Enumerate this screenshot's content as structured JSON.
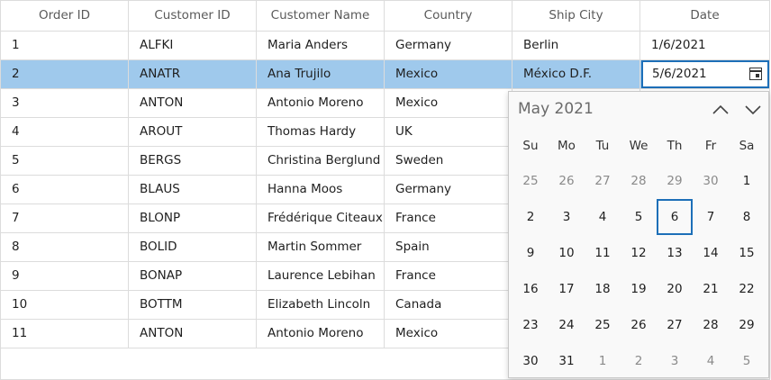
{
  "grid": {
    "columns": [
      "Order ID",
      "Customer ID",
      "Customer Name",
      "Country",
      "Ship City",
      "Date"
    ],
    "rows": [
      [
        "1",
        "ALFKI",
        "Maria Anders",
        "Germany",
        "Berlin",
        "1/6/2021"
      ],
      [
        "2",
        "ANATR",
        "Ana Trujilo",
        "Mexico",
        "México D.F.",
        ""
      ],
      [
        "3",
        "ANTON",
        "Antonio Moreno",
        "Mexico",
        "",
        ""
      ],
      [
        "4",
        "AROUT",
        "Thomas Hardy",
        "UK",
        "",
        ""
      ],
      [
        "5",
        "BERGS",
        "Christina Berglund",
        "Sweden",
        "",
        ""
      ],
      [
        "6",
        "BLAUS",
        "Hanna Moos",
        "Germany",
        "",
        ""
      ],
      [
        "7",
        "BLONP",
        "Frédérique Citeaux",
        "France",
        "",
        ""
      ],
      [
        "8",
        "BOLID",
        "Martin Sommer",
        "Spain",
        "",
        ""
      ],
      [
        "9",
        "BONAP",
        "Laurence Lebihan",
        "France",
        "",
        ""
      ],
      [
        "10",
        "BOTTM",
        "Elizabeth Lincoln",
        "Canada",
        "",
        ""
      ],
      [
        "11",
        "ANTON",
        "Antonio Moreno",
        "Mexico",
        "",
        ""
      ]
    ],
    "selected_row": 1,
    "editor_value": "5/6/2021"
  },
  "calendar": {
    "month_label": "May 2021",
    "weekdays": [
      "Su",
      "Mo",
      "Tu",
      "We",
      "Th",
      "Fr",
      "Sa"
    ],
    "weeks": [
      [
        "25",
        "26",
        "27",
        "28",
        "29",
        "30",
        "1"
      ],
      [
        "2",
        "3",
        "4",
        "5",
        "6",
        "7",
        "8"
      ],
      [
        "9",
        "10",
        "11",
        "12",
        "13",
        "14",
        "15"
      ],
      [
        "16",
        "17",
        "18",
        "19",
        "20",
        "21",
        "22"
      ],
      [
        "23",
        "24",
        "25",
        "26",
        "27",
        "28",
        "29"
      ],
      [
        "30",
        "31",
        "1",
        "2",
        "3",
        "4",
        "5"
      ]
    ],
    "muted_first_row_count": 6,
    "muted_last_row_start": 2,
    "today": "6",
    "accent_color": "#1d6fb8",
    "selection_color": "#9fc9ec"
  },
  "icons": {
    "calendar": "calendar-icon",
    "prev": "chevron-up-icon",
    "next": "chevron-down-icon"
  }
}
